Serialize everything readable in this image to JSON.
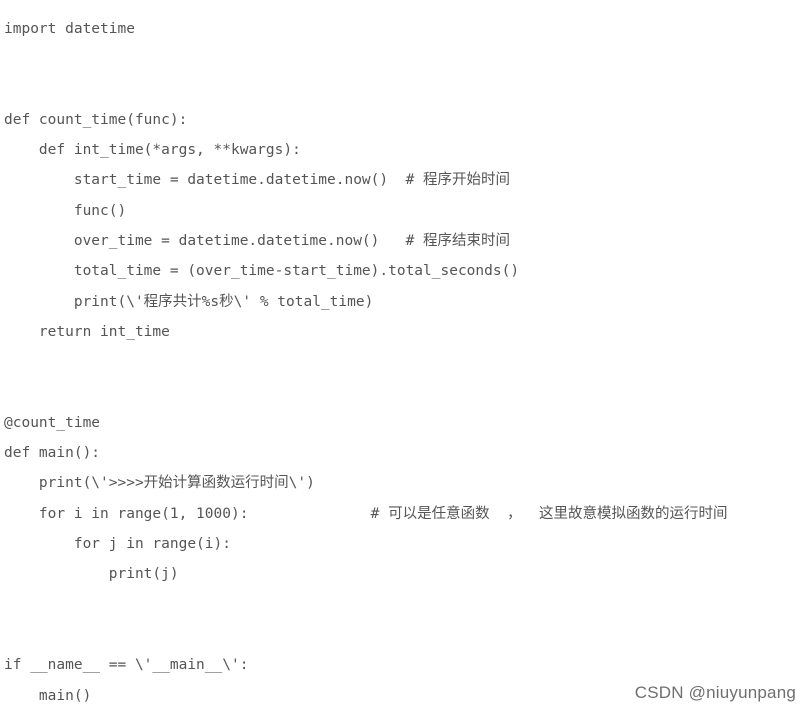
{
  "code_lines": [
    "import datetime",
    "",
    "",
    "def count_time(func):",
    "    def int_time(*args, **kwargs):",
    "        start_time = datetime.datetime.now()  # 程序开始时间",
    "        func()",
    "        over_time = datetime.datetime.now()   # 程序结束时间",
    "        total_time = (over_time-start_time).total_seconds()",
    "        print(\\'程序共计%s秒\\' % total_time)",
    "    return int_time",
    "",
    "",
    "@count_time",
    "def main():",
    "    print(\\'>>>>开始计算函数运行时间\\')",
    "    for i in range(1, 1000):              # 可以是任意函数  ，  这里故意模拟函数的运行时间",
    "        for j in range(i):",
    "            print(j)",
    "",
    "",
    "if __name__ == \\'__main__\\':",
    "    main()"
  ],
  "watermark": "CSDN @niuyunpang"
}
